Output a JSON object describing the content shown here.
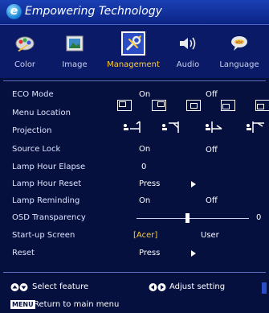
{
  "header": {
    "title": "Empowering Technology",
    "logo_letter": "e"
  },
  "tabs": [
    {
      "label": "Color",
      "icon": "color-icon"
    },
    {
      "label": "Image",
      "icon": "image-icon"
    },
    {
      "label": "Management",
      "icon": "management-icon",
      "active": true
    },
    {
      "label": "Audio",
      "icon": "audio-icon"
    },
    {
      "label": "Language",
      "icon": "language-icon"
    }
  ],
  "rows": {
    "eco_mode": {
      "label": "ECO Mode",
      "on": "On",
      "off": "Off"
    },
    "menu_location": {
      "label": "Menu Location"
    },
    "projection": {
      "label": "Projection"
    },
    "source_lock": {
      "label": "Source Lock",
      "on": "On",
      "off": "Off"
    },
    "lamp_hour_elapse": {
      "label": "Lamp Hour Elapse",
      "value": "0"
    },
    "lamp_hour_reset": {
      "label": "Lamp Hour Reset",
      "action": "Press"
    },
    "lamp_reminding": {
      "label": "Lamp Reminding",
      "on": "On",
      "off": "Off"
    },
    "osd_transparency": {
      "label": "OSD Transparency",
      "value": "0",
      "level": 0.45
    },
    "startup_screen": {
      "label": "Start-up Screen",
      "option1": "[Acer]",
      "option2": "User"
    },
    "reset": {
      "label": "Reset",
      "action": "Press"
    }
  },
  "footer": {
    "select_text": "Select feature",
    "adjust_text": "Adjust setting",
    "menu_badge": "MENU",
    "return_text": "Return to main menu"
  },
  "colors": {
    "background": "#06103f",
    "header": "#1a3fb5",
    "highlight": "#ffcc33"
  }
}
